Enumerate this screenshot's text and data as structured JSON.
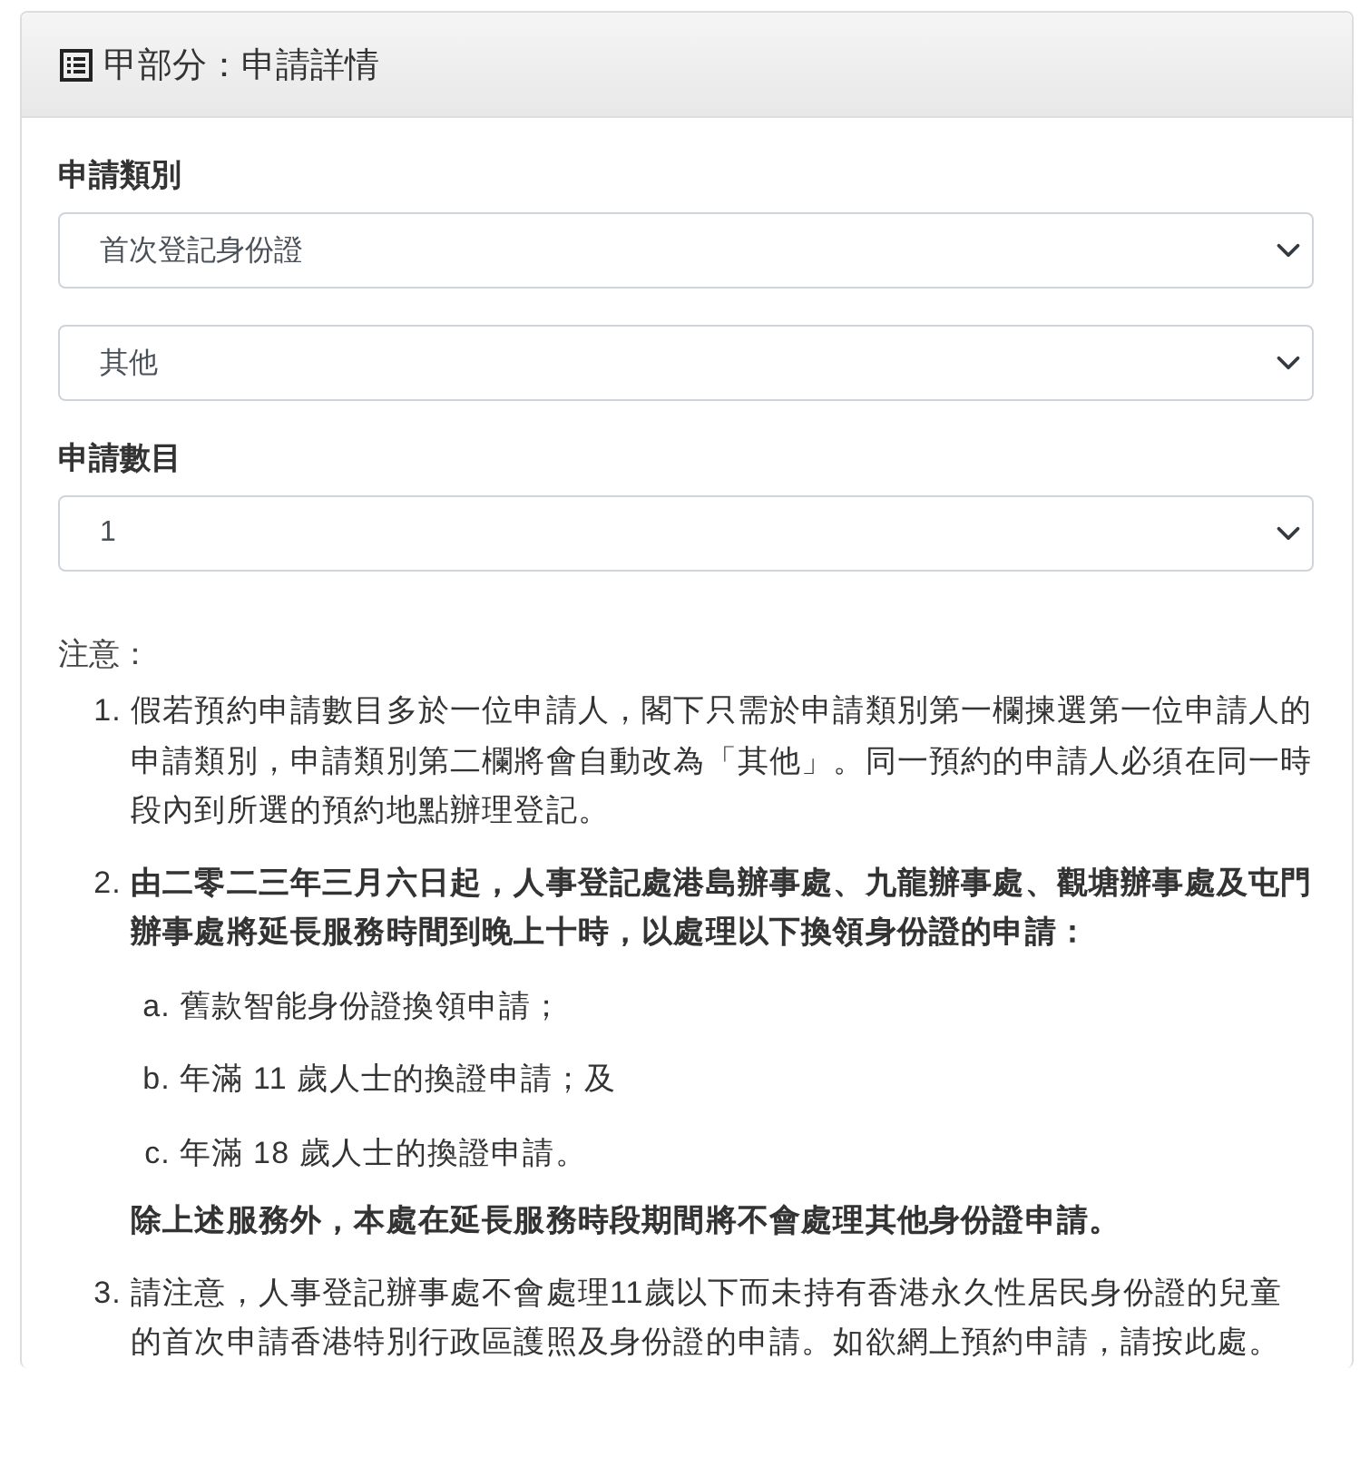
{
  "panel": {
    "title": "甲部分：申請詳情"
  },
  "fields": [
    {
      "label": "申請類別",
      "selects": [
        {
          "value": "首次登記身份證"
        },
        {
          "value": "其他"
        }
      ]
    },
    {
      "label": "申請數目",
      "selects": [
        {
          "value": "1"
        }
      ]
    }
  ],
  "notice": {
    "heading": "注意：",
    "items": [
      {
        "marker": "1.",
        "text": "假若預約申請數目多於一位申請人，閣下只需於申請類別第一欄揀選第一位申請人的申請類別，申請類別第二欄將會自動改為「其他」。同一預約的申請人必須在同一時段內到所選的預約地點辦理登記。",
        "bold": false
      },
      {
        "marker": "2.",
        "text": "由二零二三年三月六日起，人事登記處港島辦事處、九龍辦事處、觀塘辦事處及屯門辦事處將延長服務時間到晚上十時，以處理以下換領身份證的申請：",
        "bold": true,
        "subitems": [
          {
            "marker": "a.",
            "text": "舊款智能身份證換領申請；"
          },
          {
            "marker": "b.",
            "text": "年滿 11 歲人士的換證申請；及"
          },
          {
            "marker": "c.",
            "text": "年滿 18 歲人士的換證申請。"
          }
        ],
        "footer": "除上述服務外，本處在延長服務時段期間將不會處理其他身份證申請。"
      },
      {
        "marker": "3.",
        "text": "請注意，人事登記辦事處不會處理11歲以下而未持有香港永久性居民身份證的兒童的首次申請香港特別行政區護照及身份證的申請。如欲網上預約申請，請按此處。",
        "bold": false
      }
    ]
  }
}
